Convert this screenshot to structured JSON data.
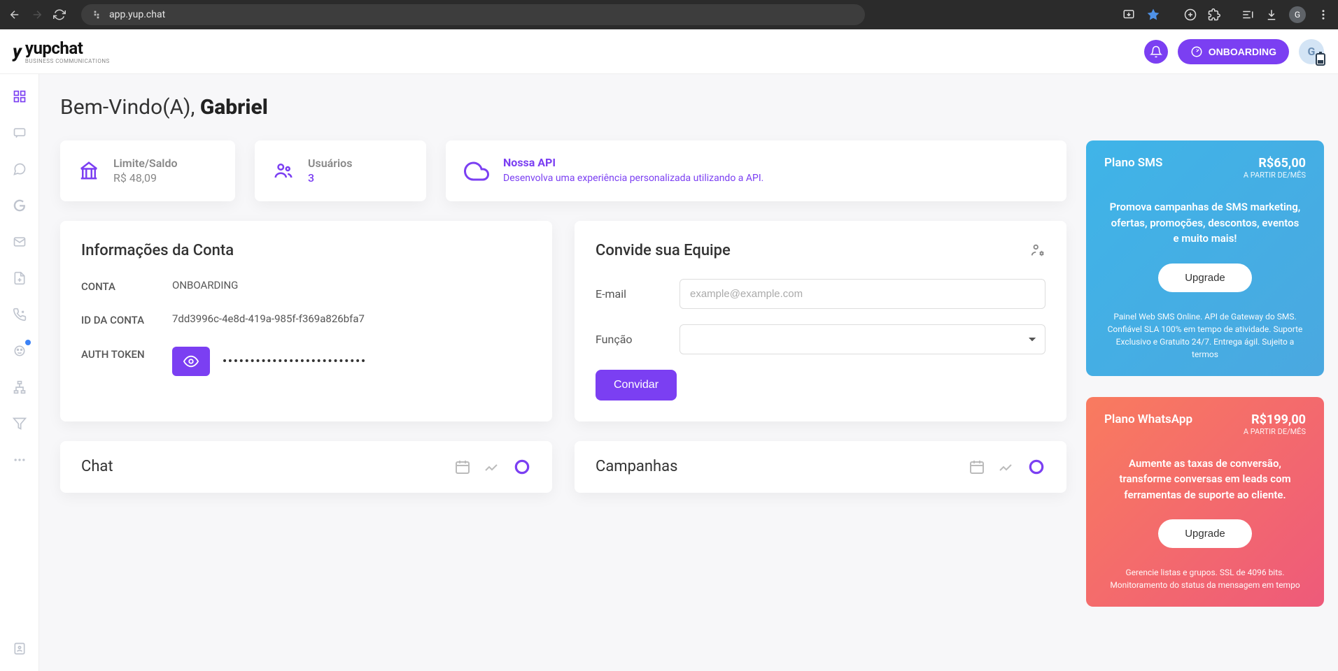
{
  "browser": {
    "url": "app.yup.chat",
    "profile_initial": "G"
  },
  "header": {
    "logo_text": "yupchat",
    "logo_sub": "BUSINESS COMMUNICATIONS",
    "onboarding_label": "ONBOARDING",
    "avatar_initial": "G"
  },
  "welcome": {
    "greeting": "Bem-Vindo(A), ",
    "username": "Gabriel"
  },
  "stats": {
    "balance": {
      "title": "Limite/Saldo",
      "value": "R$ 48,09"
    },
    "users": {
      "title": "Usuários",
      "value": "3"
    },
    "api": {
      "title": "Nossa API",
      "desc": "Desenvolva uma experiência personalizada utilizando a API."
    }
  },
  "account_info": {
    "title": "Informações da Conta",
    "rows": {
      "account_label": "CONTA",
      "account_value": "ONBOARDING",
      "id_label": "ID DA CONTA",
      "id_value": "7dd3996c-4e8d-419a-985f-f369a826bfa7",
      "token_label": "AUTH TOKEN",
      "token_masked": "••••••••••••••••••••••••••"
    }
  },
  "invite": {
    "title": "Convide sua Equipe",
    "email_label": "E-mail",
    "email_placeholder": "example@example.com",
    "role_label": "Função",
    "button": "Convidar"
  },
  "sections": {
    "chat": "Chat",
    "campaigns": "Campanhas"
  },
  "plans": {
    "sms": {
      "name": "Plano SMS",
      "price": "R$65,00",
      "per": "A PARTIR DE/MÊS",
      "desc": "Promova campanhas de SMS marketing, ofertas, promoções, descontos, eventos e muito mais!",
      "button": "Upgrade",
      "fine": "Painel Web SMS Online. API de Gateway do SMS. Confiável SLA 100% em tempo de atividade. Suporte Exclusivo e Gratuito 24/7. Entrega ágil. Sujeito a termos"
    },
    "whatsapp": {
      "name": "Plano WhatsApp",
      "price": "R$199,00",
      "per": "A PARTIR DE/MÊS",
      "desc": "Aumente as taxas de conversão, transforme conversas em leads com ferramentas de suporte ao cliente.",
      "button": "Upgrade",
      "fine": "Gerencie listas e grupos. SSL de 4096 bits. Monitoramento do status da mensagem em tempo"
    }
  }
}
